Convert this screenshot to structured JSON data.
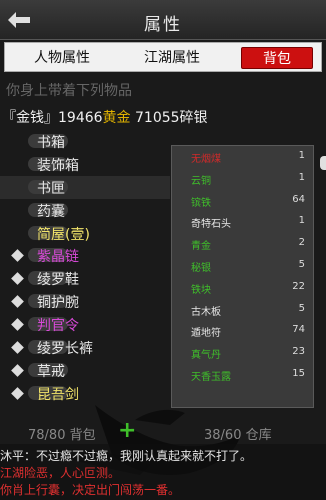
{
  "header": {
    "title": "属性"
  },
  "tabs": [
    {
      "label": "人物属性",
      "active": false
    },
    {
      "label": "江湖属性",
      "active": false
    },
    {
      "label": "背包",
      "active": true
    }
  ],
  "prompt": "你身上带着下列物品",
  "money": {
    "label": "『金钱』",
    "gold_amount": "19466",
    "gold_unit": "黄金",
    "silver_amount": "71055",
    "silver_unit": "碎银"
  },
  "inventory": [
    {
      "name": "书箱",
      "color": "#e8e8e8",
      "bullet": false,
      "selected": false
    },
    {
      "name": "装饰箱",
      "color": "#e8e8e8",
      "bullet": false,
      "selected": false
    },
    {
      "name": "书匣",
      "color": "#e8e8e8",
      "bullet": false,
      "selected": true
    },
    {
      "name": "药囊",
      "color": "#e8e8e8",
      "bullet": false,
      "selected": false
    },
    {
      "name": "简屋(壹)",
      "color": "#f2e46a",
      "bullet": false,
      "selected": false
    },
    {
      "name": "紫晶链",
      "color": "#d84ad8",
      "bullet": true,
      "selected": false
    },
    {
      "name": "绫罗鞋",
      "color": "#e8e8e8",
      "bullet": true,
      "selected": false
    },
    {
      "name": "铜护腕",
      "color": "#e8e8e8",
      "bullet": true,
      "selected": false
    },
    {
      "name": "判官令",
      "color": "#d84ad8",
      "bullet": true,
      "selected": false
    },
    {
      "name": "绫罗长裤",
      "color": "#e8e8e8",
      "bullet": true,
      "selected": false
    },
    {
      "name": "草戒",
      "color": "#e8e8e8",
      "bullet": true,
      "selected": false
    },
    {
      "name": "昆吾剑",
      "color": "#f2e46a",
      "bullet": true,
      "selected": false
    }
  ],
  "materials": [
    {
      "name": "无烟煤",
      "count": "1",
      "color": "#d02a2a"
    },
    {
      "name": "云铜",
      "count": "1",
      "color": "#3fbf2a"
    },
    {
      "name": "镔铁",
      "count": "64",
      "color": "#3fbf2a"
    },
    {
      "name": "奇特石头",
      "count": "1",
      "color": "#e6e6e6"
    },
    {
      "name": "青金",
      "count": "2",
      "color": "#3fbf2a"
    },
    {
      "name": "秘银",
      "count": "5",
      "color": "#3fbf2a"
    },
    {
      "name": "铁块",
      "count": "22",
      "color": "#3fbf2a"
    },
    {
      "name": "古木板",
      "count": "5",
      "color": "#e6e6e6"
    },
    {
      "name": "遁地符",
      "count": "74",
      "color": "#e6e6e6"
    },
    {
      "name": "真气丹",
      "count": "23",
      "color": "#3fbf2a"
    },
    {
      "name": "天香玉露",
      "count": "15",
      "color": "#3fbf2a"
    }
  ],
  "capacity": {
    "bag": "78/80 背包",
    "warehouse": "38/60 仓库",
    "add_symbol": "+"
  },
  "footer": {
    "line1": "沐平：不过瘾不过瘾，我刚认真起来就不打了。",
    "line2": "江湖险恶，人心叵测。",
    "line3": "你肖上行囊，决定出门闯荡一番。"
  },
  "icons": {
    "back": "back-arrow-icon",
    "add": "plus-icon"
  },
  "colors": {
    "active_tab": "#cc1010",
    "gold": "#e0b200",
    "rare_green": "#3fbf2a",
    "rare_purple": "#d84ad8",
    "rare_red": "#d02a2a"
  }
}
